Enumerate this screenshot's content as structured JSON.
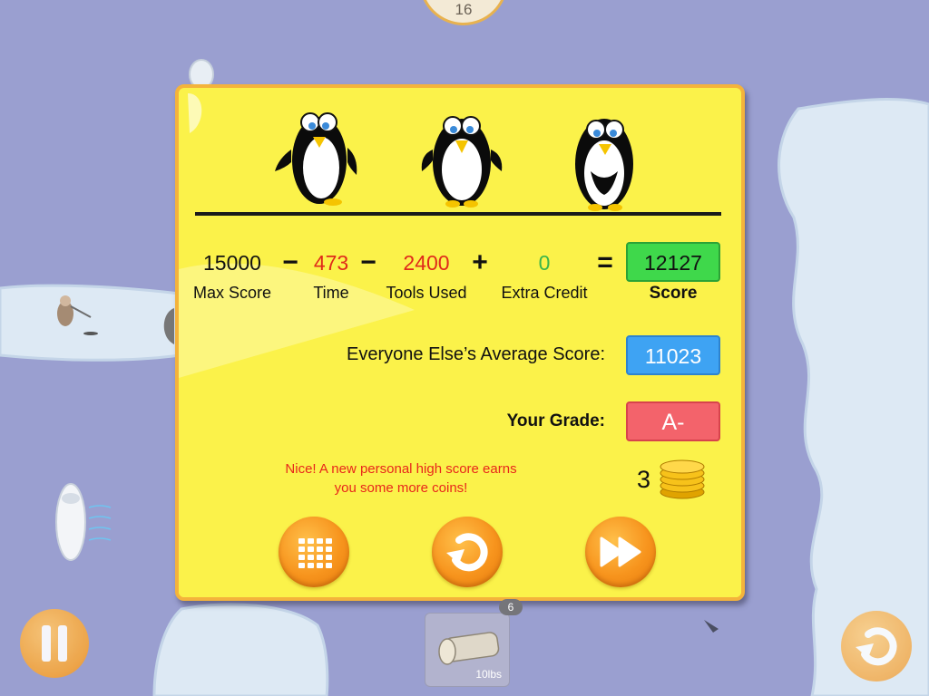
{
  "top_counter": {
    "value": "16"
  },
  "dialog": {
    "score_row": {
      "max_score": {
        "value": "15000",
        "label": "Max Score"
      },
      "op_minus_1": "−",
      "time": {
        "value": "473",
        "label": "Time"
      },
      "op_minus_2": "−",
      "tools_used": {
        "value": "2400",
        "label": "Tools Used"
      },
      "op_plus": "+",
      "extra_credit": {
        "value": "0",
        "label": "Extra Credit"
      },
      "op_equals": "=",
      "score": {
        "value": "12127",
        "label": "Score"
      }
    },
    "average": {
      "label": "Everyone Else’s Average Score:",
      "value": "11023"
    },
    "grade": {
      "label": "Your Grade:",
      "value": "A-"
    },
    "message": {
      "line1": "Nice! A new personal high score earns",
      "line2": "you some more coins!"
    },
    "coins": {
      "count": "3"
    },
    "buttons": {
      "menu": "level-grid-icon",
      "replay": "replay-icon",
      "next": "fast-forward-icon"
    }
  },
  "tool_slot": {
    "count": "6",
    "weight_label": "10lbs"
  },
  "colors": {
    "background": "#9a9fd0",
    "dialog": "#fbf24a",
    "dialog_border": "#f4b33b",
    "time_and_tools": "#e02a1a",
    "extra_credit": "#39b54a",
    "score_box": "#3fd84b",
    "average_box": "#3ea3f3",
    "grade_box": "#f3636b",
    "message_text": "#e8261b",
    "button_orange": "#f7941d"
  }
}
